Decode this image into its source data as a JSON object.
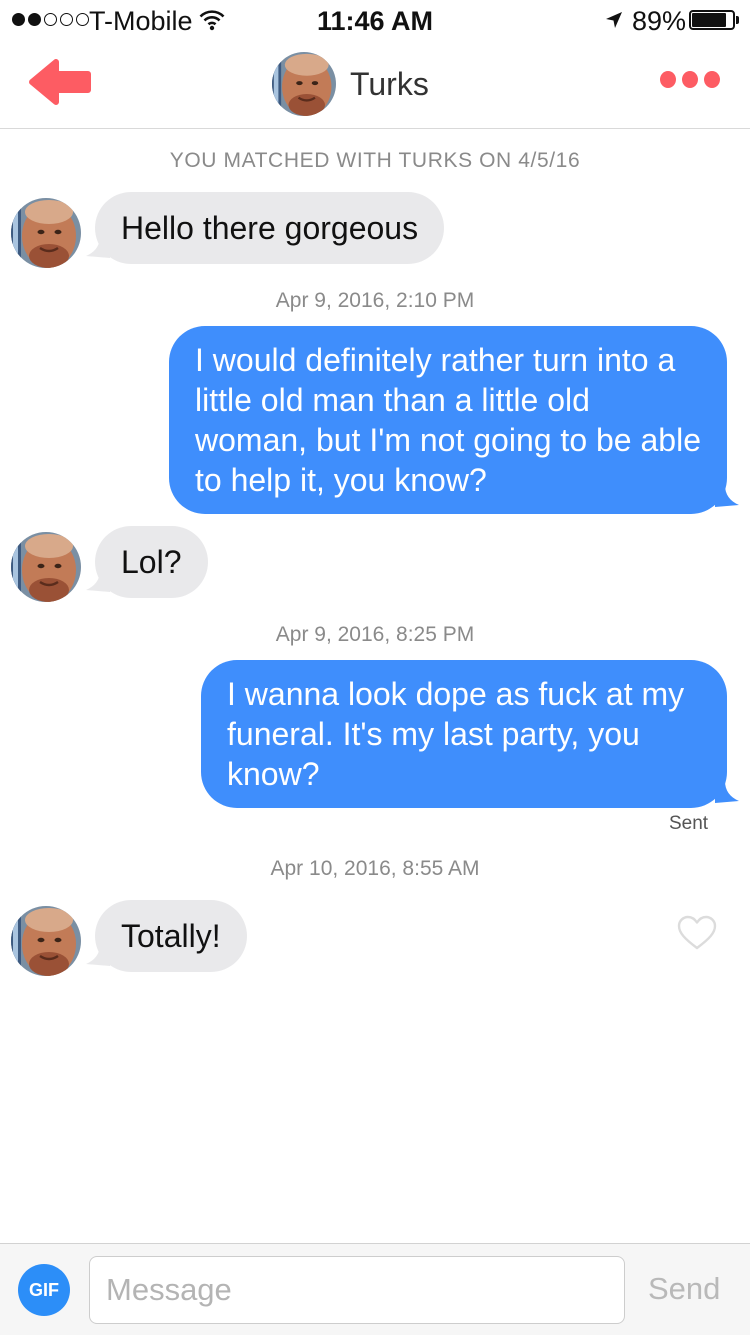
{
  "status_bar": {
    "carrier": "T-Mobile",
    "time": "11:46 AM",
    "battery_percent": "89%",
    "battery_level": 0.89,
    "signal_bars_filled": 2,
    "signal_bars_total": 5
  },
  "nav": {
    "contact_name": "Turks",
    "back_icon": "back-arrow-icon",
    "more_icon": "more-dots-icon",
    "accent_color": "#fd5c63"
  },
  "chat": {
    "match_note": "YOU MATCHED WITH TURKS ON 4/5/16",
    "messages": [
      {
        "direction": "incoming",
        "text": "Hello there gorgeous"
      },
      {
        "timestamp": "Apr 9, 2016, 2:10 PM"
      },
      {
        "direction": "outgoing",
        "text": "I would definitely rather turn into a little old man than a little old woman, but I'm not going to be able to help it, you know?"
      },
      {
        "direction": "incoming",
        "text": "Lol?"
      },
      {
        "timestamp": "Apr 9, 2016, 8:25 PM"
      },
      {
        "direction": "outgoing",
        "text": "I wanna look dope as fuck at my funeral. It's my last party, you know?",
        "status": "Sent"
      },
      {
        "timestamp": "Apr 10, 2016, 8:55 AM"
      },
      {
        "direction": "incoming",
        "text": "Totally!",
        "liked": false
      }
    ],
    "outgoing_color": "#3f8efc",
    "incoming_color": "#e9e9eb"
  },
  "input_bar": {
    "gif_label": "GIF",
    "message_placeholder": "Message",
    "message_value": "",
    "send_label": "Send"
  }
}
